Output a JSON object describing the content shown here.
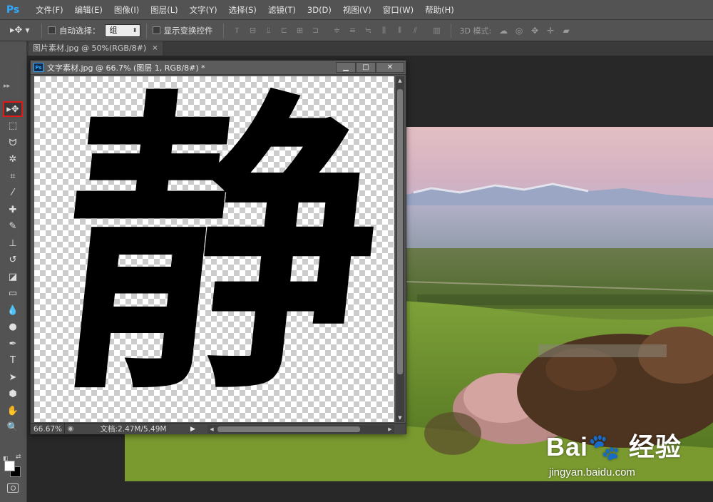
{
  "app": {
    "logo": "Ps",
    "menus": [
      "文件(F)",
      "编辑(E)",
      "图像(I)",
      "图层(L)",
      "文字(Y)",
      "选择(S)",
      "滤镜(T)",
      "3D(D)",
      "视图(V)",
      "窗口(W)",
      "帮助(H)"
    ]
  },
  "options": {
    "move_icon": "▸✥",
    "auto_select_label": "自动选择：",
    "auto_select_value": "组",
    "show_transform_label": "显示变换控件",
    "mode_label": "3D 模式:",
    "align_icons": [
      "align-top-icon",
      "align-vcenter-icon",
      "align-bottom-icon",
      "align-left-icon",
      "align-hcenter-icon",
      "align-right-icon",
      "dist-top-icon",
      "dist-vcenter-icon",
      "dist-bottom-icon",
      "dist-left-icon",
      "dist-hcenter-icon",
      "dist-right-icon",
      "auto-align-icon"
    ],
    "mode_icons": [
      "rotate-3d-icon",
      "roll-3d-icon",
      "drag-3d-icon",
      "slide-3d-icon",
      "scale-3d-icon"
    ]
  },
  "tabs": {
    "main_tab": "图片素材.jpg @ 50%(RGB/8#)",
    "close": "×"
  },
  "float_window": {
    "title": "文字素材.jpg @ 66.7% (图层 1, RGB/8#) *",
    "minimize": "▁",
    "maximize": "□",
    "close": "✕",
    "calligraphy": "静",
    "zoom": "66.67%",
    "doc_size": "文档:2.47M/5.49M"
  },
  "tools": [
    {
      "name": "move-tool",
      "glyph": "▸✥",
      "active": true
    },
    {
      "name": "marquee-tool",
      "glyph": "⬚"
    },
    {
      "name": "lasso-tool",
      "glyph": "ᗢ"
    },
    {
      "name": "magic-wand-tool",
      "glyph": "✲"
    },
    {
      "name": "crop-tool",
      "glyph": "⌗"
    },
    {
      "name": "eyedropper-tool",
      "glyph": "⁄"
    },
    {
      "name": "healing-brush-tool",
      "glyph": "✚"
    },
    {
      "name": "brush-tool",
      "glyph": "✎"
    },
    {
      "name": "clone-stamp-tool",
      "glyph": "⊥"
    },
    {
      "name": "history-brush-tool",
      "glyph": "↺"
    },
    {
      "name": "eraser-tool",
      "glyph": "◪"
    },
    {
      "name": "gradient-tool",
      "glyph": "▭"
    },
    {
      "name": "blur-tool",
      "glyph": "💧"
    },
    {
      "name": "dodge-tool",
      "glyph": "●"
    },
    {
      "name": "pen-tool",
      "glyph": "✒"
    },
    {
      "name": "type-tool",
      "glyph": "T"
    },
    {
      "name": "path-selection-tool",
      "glyph": "➤"
    },
    {
      "name": "shape-tool",
      "glyph": "⬢"
    },
    {
      "name": "hand-tool",
      "glyph": "✋"
    },
    {
      "name": "zoom-tool",
      "glyph": "🔍"
    }
  ],
  "watermark": {
    "logo": "Bai🐾 经验",
    "url": "jingyan.baidu.com"
  }
}
